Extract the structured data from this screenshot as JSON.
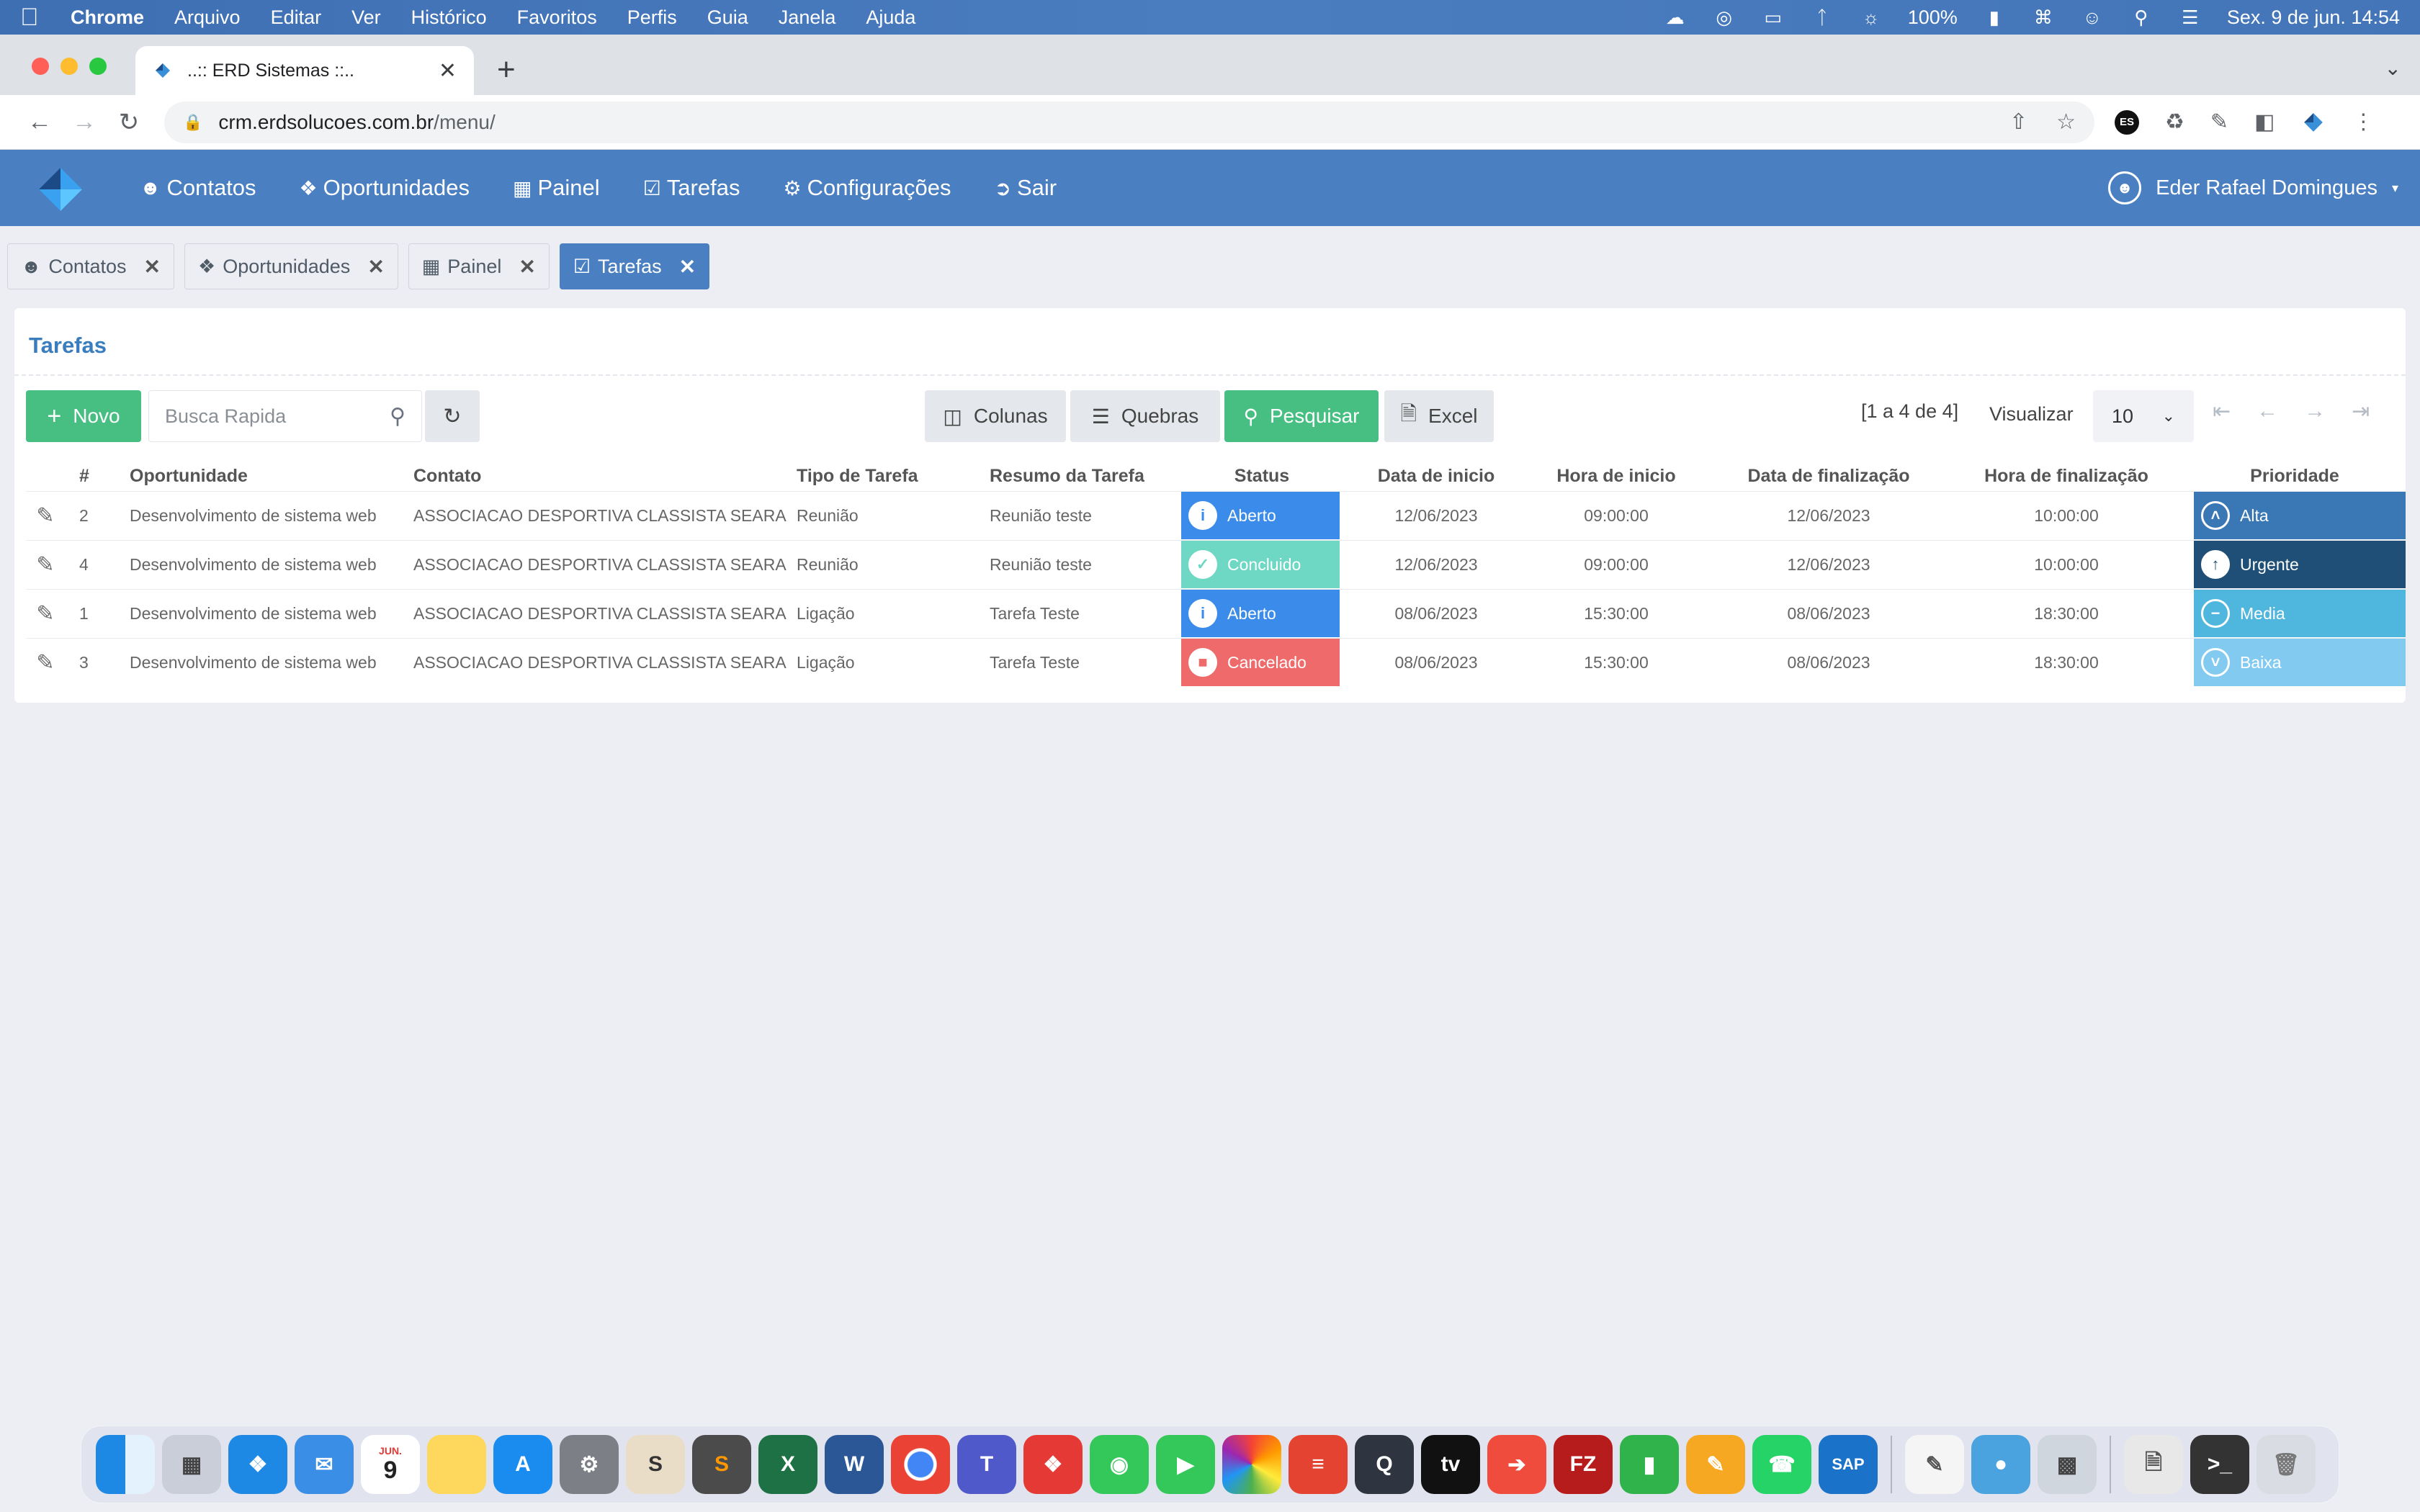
{
  "macos_menubar": {
    "app_name": "Chrome",
    "menus": [
      "Arquivo",
      "Editar",
      "Ver",
      "Histórico",
      "Favoritos",
      "Perfis",
      "Guia",
      "Janela",
      "Ajuda"
    ],
    "battery": "100%",
    "clock": "Sex. 9 de jun.  14:54"
  },
  "browser": {
    "tab_title": "..:: ERD Sistemas ::..",
    "url_host": "crm.erdsolucoes.com.br",
    "url_path": "/menu/",
    "extension_es": "ES"
  },
  "app_header": {
    "nav": [
      {
        "label": "Contatos",
        "icon": "user-icon"
      },
      {
        "label": "Oportunidades",
        "icon": "tags-icon"
      },
      {
        "label": "Painel",
        "icon": "table-icon"
      },
      {
        "label": "Tarefas",
        "icon": "clipboard-check-icon"
      },
      {
        "label": "Configurações",
        "icon": "gears-icon"
      },
      {
        "label": "Sair",
        "icon": "sign-out-icon"
      }
    ],
    "user_name": "Eder Rafael Domingues"
  },
  "app_tabs": [
    {
      "label": "Contatos",
      "active": false
    },
    {
      "label": "Oportunidades",
      "active": false
    },
    {
      "label": "Painel",
      "active": false
    },
    {
      "label": "Tarefas",
      "active": true
    }
  ],
  "panel": {
    "title": "Tarefas",
    "toolbar": {
      "novo_label": "Novo",
      "search_placeholder": "Busca Rapida",
      "colunas_label": "Colunas",
      "quebras_label": "Quebras",
      "pesquisar_label": "Pesquisar",
      "excel_label": "Excel"
    },
    "pager": {
      "count": "[1 a 4 de 4]",
      "visualizar_label": "Visualizar",
      "page_size": "10"
    }
  },
  "table": {
    "headers": {
      "num": "#",
      "oportunidade": "Oportunidade",
      "contato": "Contato",
      "tipo": "Tipo de Tarefa",
      "resumo": "Resumo da Tarefa",
      "status": "Status",
      "data_inicio": "Data de inicio",
      "hora_inicio": "Hora de inicio",
      "data_fim": "Data de finalização",
      "hora_fim": "Hora de finalização",
      "prioridade": "Prioridade"
    },
    "rows": [
      {
        "num": "2",
        "oportunidade": "Desenvolvimento de sistema web",
        "contato": "ASSOCIACAO DESPORTIVA CLASSISTA SEARA",
        "tipo": "Reunião",
        "resumo": "Reunião teste",
        "status": "Aberto",
        "data_inicio": "12/06/2023",
        "hora_inicio": "09:00:00",
        "data_fim": "12/06/2023",
        "hora_fim": "10:00:00",
        "prioridade": "Alta"
      },
      {
        "num": "4",
        "oportunidade": "Desenvolvimento de sistema web",
        "contato": "ASSOCIACAO DESPORTIVA CLASSISTA SEARA",
        "tipo": "Reunião",
        "resumo": "Reunião teste",
        "status": "Concluido",
        "data_inicio": "12/06/2023",
        "hora_inicio": "09:00:00",
        "data_fim": "12/06/2023",
        "hora_fim": "10:00:00",
        "prioridade": "Urgente"
      },
      {
        "num": "1",
        "oportunidade": "Desenvolvimento de sistema web",
        "contato": "ASSOCIACAO DESPORTIVA CLASSISTA SEARA",
        "tipo": "Ligação",
        "resumo": "Tarefa Teste",
        "status": "Aberto",
        "data_inicio": "08/06/2023",
        "hora_inicio": "15:30:00",
        "data_fim": "08/06/2023",
        "hora_fim": "18:30:00",
        "prioridade": "Media"
      },
      {
        "num": "3",
        "oportunidade": "Desenvolvimento de sistema web",
        "contato": "ASSOCIACAO DESPORTIVA CLASSISTA SEARA",
        "tipo": "Ligação",
        "resumo": "Tarefa Teste",
        "status": "Cancelado",
        "data_inicio": "08/06/2023",
        "hora_inicio": "15:30:00",
        "data_fim": "08/06/2023",
        "hora_fim": "18:30:00",
        "prioridade": "Baixa"
      }
    ]
  },
  "colors": {
    "header_blue": "#4a7fc1",
    "green": "#47bf83",
    "status_aberto": "#3b8bea",
    "status_concluido": "#6ed8c4",
    "status_cancelado": "#ef6b6b",
    "prio_alta": "#3a77b5",
    "prio_urgente": "#1f4f76",
    "prio_media": "#4fb6dd",
    "prio_baixa": "#82caf0"
  },
  "dock": {
    "calendar_month": "JUN.",
    "calendar_day": "9",
    "apps": [
      "finder-icon",
      "launchpad-icon",
      "safari-icon",
      "mail-icon",
      "calendar-icon",
      "notes-icon",
      "app-store-icon",
      "system-settings-icon",
      "sequel-icon",
      "sublime-icon",
      "excel-icon",
      "word-icon",
      "chrome-icon",
      "teams-icon",
      "anydesk-icon",
      "messages-icon",
      "facetime-icon",
      "photos-icon",
      "todoist-icon",
      "quicktime-icon",
      "apple-tv-icon",
      "remote-icon",
      "filezilla-icon",
      "numbers-icon",
      "pages-icon",
      "whatsapp-icon",
      "sap-icon",
      "textedit-icon",
      "preview-icon",
      "migration-icon",
      "archive-icon",
      "terminal-icon",
      "trash-icon"
    ]
  }
}
